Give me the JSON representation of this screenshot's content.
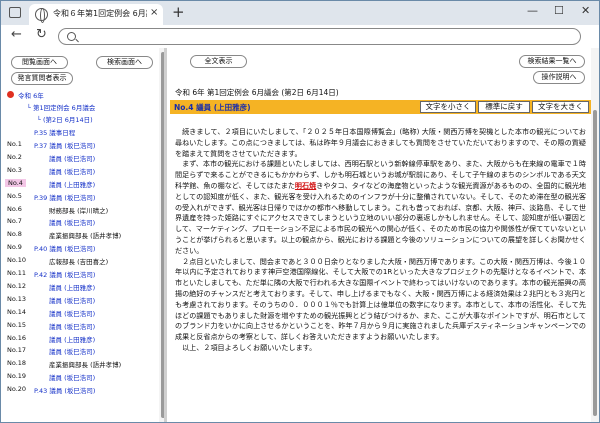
{
  "browser": {
    "tab_title": "令和６年第1回定例会 6月議会 (第",
    "tab_close": "×",
    "tab_new": "+",
    "min_glyph": "—",
    "max_glyph": "☐",
    "close_glyph": "✕",
    "back_glyph": "←",
    "reload_glyph": "↻",
    "address_value": ""
  },
  "left": {
    "buttons": {
      "prev_screen": "閲覧画面へ",
      "search_screen": "検索画面へ",
      "speaker_list": "発言質問者表示"
    },
    "tree": {
      "era": "令和 6年",
      "session": "第1回定例会 6月議会",
      "day": "(第2日 6月14日)",
      "p35": "P.35 議事日程"
    },
    "entries": [
      {
        "num": "No.1",
        "page": "P.37",
        "text": "議員 (坂巳浩司)",
        "color": "blue"
      },
      {
        "num": "No.2",
        "page": "",
        "text": "議員 (坂巳浩司)",
        "color": "blue"
      },
      {
        "num": "No.3",
        "page": "",
        "text": "議員 (坂巳浩司)",
        "color": "blue"
      },
      {
        "num": "No.4",
        "page": "",
        "text": "議員 (上田雅彦)",
        "color": "blue"
      },
      {
        "num": "No.5",
        "page": "P.39",
        "text": "議員 (坂巳浩司)",
        "color": "blue"
      },
      {
        "num": "No.6",
        "page": "",
        "text": "財務部長 (岸川晴之)",
        "color": "dark"
      },
      {
        "num": "No.7",
        "page": "",
        "text": "議員 (坂巳浩司)",
        "color": "blue"
      },
      {
        "num": "No.8",
        "page": "",
        "text": "産業振興部長 (語井孝博)",
        "color": "dark"
      },
      {
        "num": "No.9",
        "page": "P.40",
        "text": "議員 (坂巳浩司)",
        "color": "blue"
      },
      {
        "num": "No.10",
        "page": "",
        "text": "広報部長 (吉田喜之)",
        "color": "dark"
      },
      {
        "num": "No.11",
        "page": "P.42",
        "text": "議員 (坂巳浩司)",
        "color": "blue"
      },
      {
        "num": "No.12",
        "page": "",
        "text": "議員 (上田雅彦)",
        "color": "blue"
      },
      {
        "num": "No.13",
        "page": "",
        "text": "議員 (坂巳浩司)",
        "color": "blue"
      },
      {
        "num": "No.14",
        "page": "",
        "text": "議員 (坂巳浩司)",
        "color": "blue"
      },
      {
        "num": "No.15",
        "page": "",
        "text": "議員 (坂巳浩司)",
        "color": "blue"
      },
      {
        "num": "No.16",
        "page": "",
        "text": "議員 (上田雅彦)",
        "color": "blue"
      },
      {
        "num": "No.17",
        "page": "",
        "text": "議員 (坂巳浩司)",
        "color": "blue"
      },
      {
        "num": "No.18",
        "page": "",
        "text": "産業振興部長 (語井孝博)",
        "color": "dark"
      },
      {
        "num": "No.19",
        "page": "",
        "text": "議員 (坂巳浩司)",
        "color": "blue"
      },
      {
        "num": "No.20",
        "page": "P.43",
        "text": "議員 (坂巳浩司)",
        "color": "blue"
      }
    ],
    "selected_indicator": "▶"
  },
  "right": {
    "buttons": {
      "full_view": "全文表示",
      "to_results": "検索結果一覧へ",
      "help": "操作説明へ"
    },
    "doc_title": "令和 6年 第1回定例会 6月議会 (第2日 6月14日)",
    "speaker": "No.4 議員 (上田雅彦)",
    "font_small": "文字を小さく",
    "font_reset": "標準に戻す",
    "font_large": "文字を大きく",
    "body": {
      "p1": "続きまして、２項目にいたしまして、「２０２５年日本国際博覧会」(略称) 大阪・関西万博を契機とした本市の観光についてお尋ねいたします。この点につきましては、私は昨年９月議会におきましても質問をさせていただいておりますので、その際の質疑を踏まえて質問をさせていただきます。",
      "p2a": "まず、本市の観光における課題といたしましては、西明石駅という新幹線停車駅をあり、また、大阪からも在来線の電車で１時間足らずで来ることができるにもかかわらず、しかも明石城というお城が駅前にあり、そして子午線のまちのシンボルである天文科学館、魚の棚など、そしてほたまた",
      "p2_highlight": "明石焼",
      "p2b": "きやタコ、タイなどの海産物といったような観光資源があるものの、全国的に観光地としての認知度が低く、また、観光客を受け入れるためのインフラが十分に整備されていない。そして、そのため滞在型の観光客の受入れができず、観光客は日帰りでほかの都市へ移動してしまう。これも昔っておれば、京都、大阪、神戸、淡路島、そして世界遺産を持った姫路にすぐにアクセスできてしまうという立地のいい部分の裏返しかもしれません。そして、認知度が低い要因として、マーケティング、プロモーション不足による市民の観光への関心が低く、そのため市民の協力や関係性が保てていないということが挙げられると思います。以上の観点から、観光における課題と今後のソリューションについての展望を詳しくお聞かせください。",
      "p3": "２点目といたしまして、閲会まであと３００日余りとなりました大阪・関西万博であります。この大阪・関西万博は、今後１０年以内に予定されております神戸空港国際線化、そして大阪での1Rといった大きなプロジェクトの先駆けとなるイベントで、本市といたしましても、ただ単に隣の大阪で行われる大きな国際イベントで終わってはいけないのであります。本市の観光振興の高揚の絶好のチャンスだと考えております。そして、申し上げるまでもなく、大阪・関西万博による経済効果は２兆円とも３兆円とも考慮されております。そのうちの０．０００１％でも計算上は億単位の数字になります。本市として、本市の活性化、そして先ほどの課題でもありました財源を増やすための観光振興とどう結びつけるか、また、ここが大事なポイントですが、明石市としてのブランド力をいかに向上させるかということを、昨年７月から９月に実施されました兵庫デスティネーションキャンペーンでの成果と反省点からの考察として、詳しくお答えいただきますようお願いいたします。",
      "p4": "以上、２項目よろしくお願いいたします。"
    }
  }
}
